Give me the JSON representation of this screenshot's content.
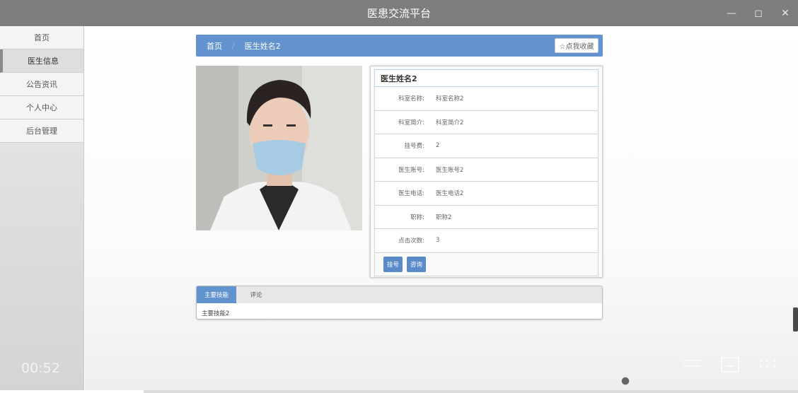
{
  "window": {
    "title": "医患交流平台",
    "controls": [
      "minimize-icon",
      "maximize-icon",
      "close-icon"
    ]
  },
  "sidebar": {
    "items": [
      {
        "label": "首页",
        "active": false
      },
      {
        "label": "医生信息",
        "active": true
      },
      {
        "label": "公告资讯",
        "active": false
      },
      {
        "label": "个人中心",
        "active": false
      },
      {
        "label": "后台管理",
        "active": false
      }
    ]
  },
  "breadcrumb": {
    "home": "首页",
    "current": "医生姓名2",
    "favorite_label": "☆点我收藏"
  },
  "doctor": {
    "name": "医生姓名2",
    "fields": [
      {
        "label": "科室名称:",
        "value": "科室名称2"
      },
      {
        "label": "科室简介:",
        "value": "科室简介2"
      },
      {
        "label": "挂号费:",
        "value": "2"
      },
      {
        "label": "医生账号:",
        "value": "医生账号2"
      },
      {
        "label": "医生电话:",
        "value": "医生电话2"
      },
      {
        "label": "职称:",
        "value": "职称2"
      },
      {
        "label": "点击次数:",
        "value": "3"
      }
    ],
    "actions": {
      "register": "挂号",
      "consult": "咨询"
    }
  },
  "tabs": {
    "items": [
      {
        "label": "主要技能",
        "active": true
      },
      {
        "label": "评论",
        "active": false
      }
    ],
    "content": "主要技能2"
  },
  "video": {
    "elapsed": "00:52",
    "progress": 0.18
  },
  "colors": {
    "accent": "#6293cf",
    "titlebar": "#7d7d7d"
  }
}
